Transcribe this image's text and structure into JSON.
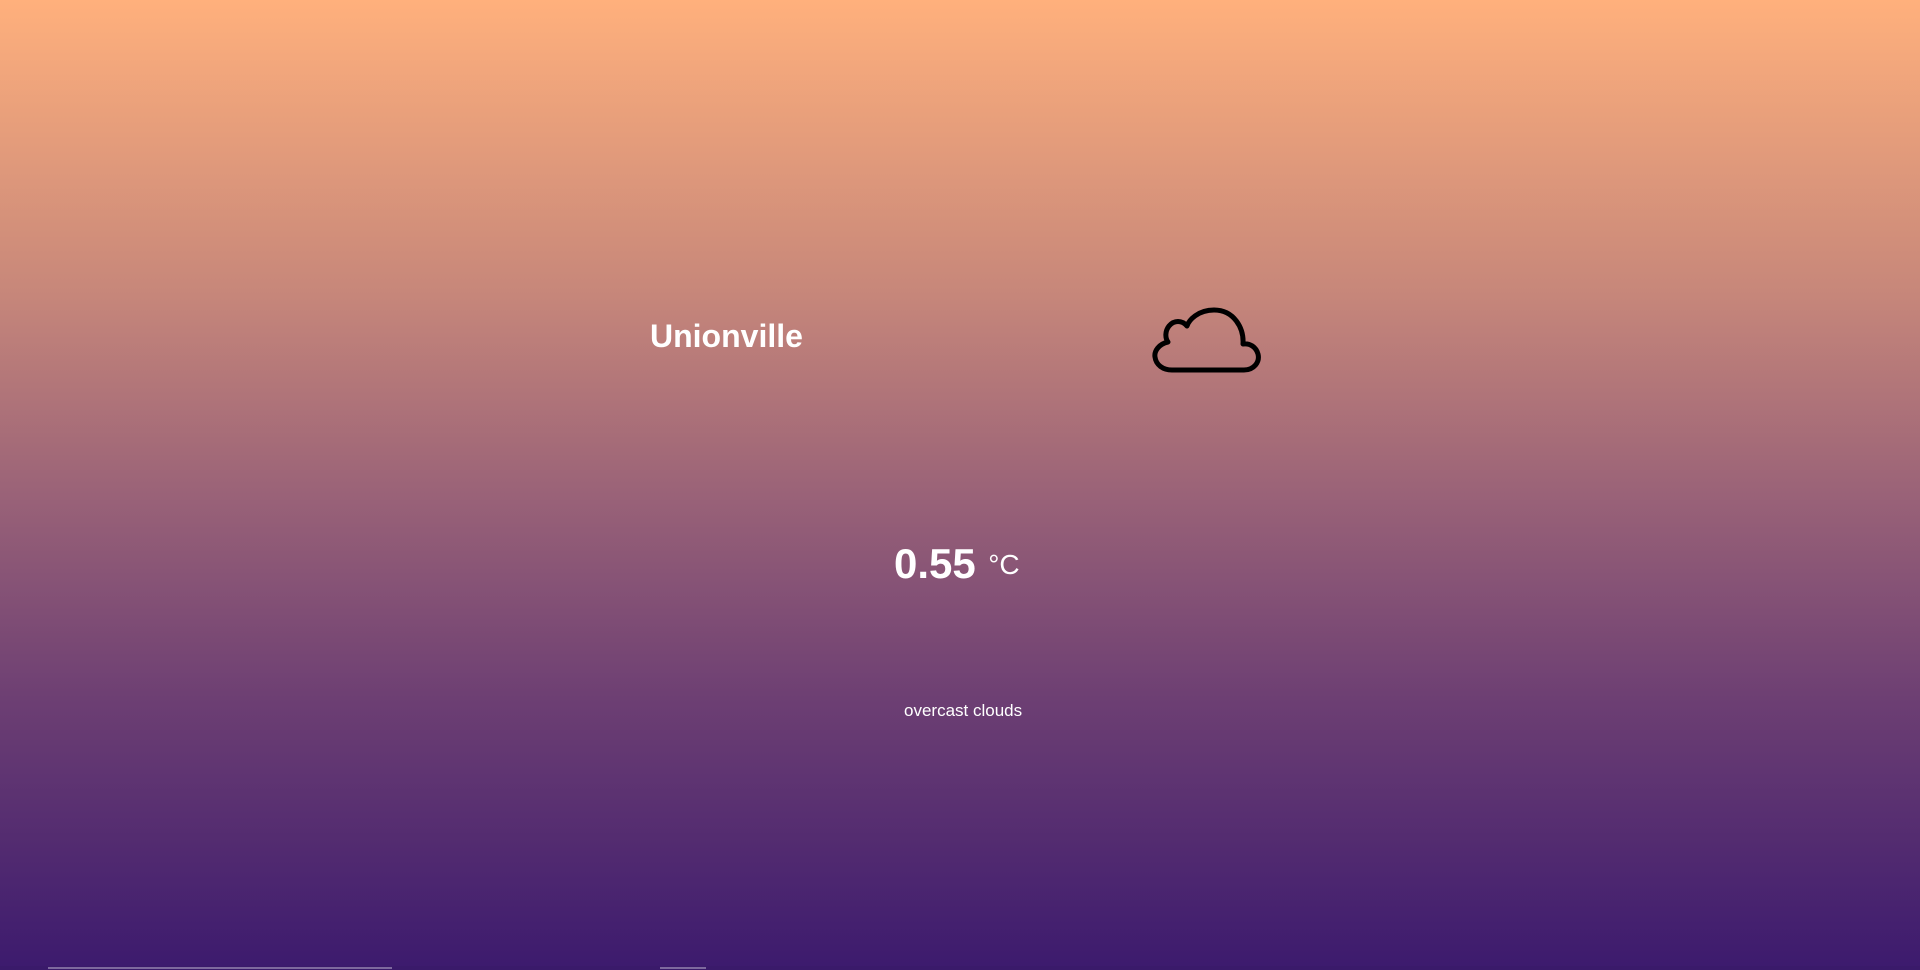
{
  "location": {
    "city": "Unionville"
  },
  "weather": {
    "icon": "cloud-icon",
    "temperature": "0.55",
    "unit": "°C",
    "description": "overcast clouds"
  },
  "colors": {
    "gradient_top": "#ffb07c",
    "gradient_bottom": "#3c1a6e",
    "text": "#ffffff",
    "icon_stroke": "#000000"
  }
}
